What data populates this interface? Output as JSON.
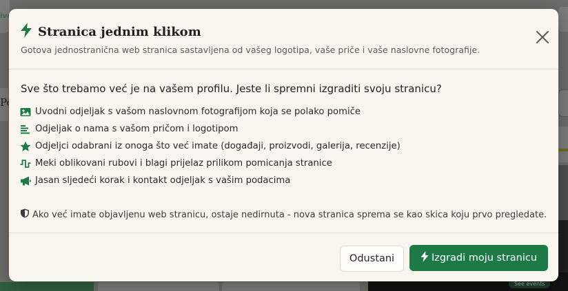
{
  "colors": {
    "accent": "#1d7a47",
    "modal_background": "#f8f6ef",
    "text": "#1f1f1f",
    "muted_text": "#5a5a58"
  },
  "background": {
    "left_fragment": "ivr",
    "left_card_fragment": "Po",
    "events_badge": "See events"
  },
  "modal": {
    "title": "Stranica jednim klikom",
    "title_icon": "lightning-bolt-icon",
    "subtitle": "Gotova jednostranična web stranica sastavljena od vašeg logotipa, vaše priče i vaše naslovne fotografije.",
    "close_icon": "close-icon",
    "question": "Sve što trebamo već je na vašem profilu. Jeste li spremni izgraditi svoju stranicu?",
    "features": [
      {
        "icon": "image-icon",
        "text": "Uvodni odjeljak s vašom naslovnom fotografijom koja se polako pomiče"
      },
      {
        "icon": "text-lines-icon",
        "text": "Odjeljak o nama s vašom pričom i logotipom"
      },
      {
        "icon": "star-icon",
        "text": "Odjeljci odabrani iz onoga što već imate (događaji, proizvodi, galerija, recenzije)"
      },
      {
        "icon": "wave-pulse-icon",
        "text": "Meki oblikovani rubovi i blagi prijelaz prilikom pomicanja stranice"
      },
      {
        "icon": "megaphone-icon",
        "text": "Jasan sljedeći korak i kontakt odjeljak s vašim podacima"
      }
    ],
    "note_icon": "shield-icon",
    "note": "Ako već imate objavljenu web stranicu, ostaje nedirnuta - nova stranica sprema se kao skica koju prvo pregledate.",
    "cancel_label": "Odustani",
    "primary_label": "Izgradi moju stranicu",
    "primary_icon": "lightning-bolt-icon"
  }
}
